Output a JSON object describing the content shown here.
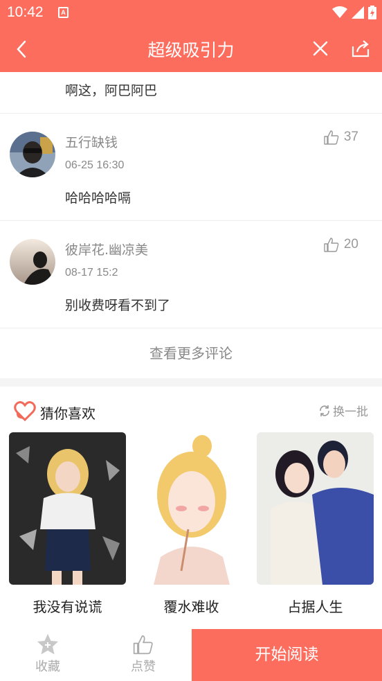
{
  "status": {
    "time": "10:42"
  },
  "header": {
    "title": "超级吸引力"
  },
  "previous_comment": {
    "text": "啊这，阿巴阿巴"
  },
  "comments": [
    {
      "name": "五行缺钱",
      "date": "06-25 16:30",
      "text": "哈哈哈哈嗝",
      "likes": "37"
    },
    {
      "name": "彼岸花.幽凉美",
      "date": "08-17 15:2",
      "text": "别收费呀看不到了",
      "likes": "20"
    }
  ],
  "more_comments": "查看更多评论",
  "recommend": {
    "title": "猜你喜欢",
    "refresh_label": "换一批",
    "items": [
      {
        "name": "我没有说谎"
      },
      {
        "name": "覆水难收"
      },
      {
        "name": "占据人生"
      }
    ]
  },
  "bottom_bar": {
    "collect_label": "收藏",
    "like_label": "点赞",
    "read_label": "开始阅读"
  },
  "colors": {
    "accent": "#fd6d5e"
  }
}
